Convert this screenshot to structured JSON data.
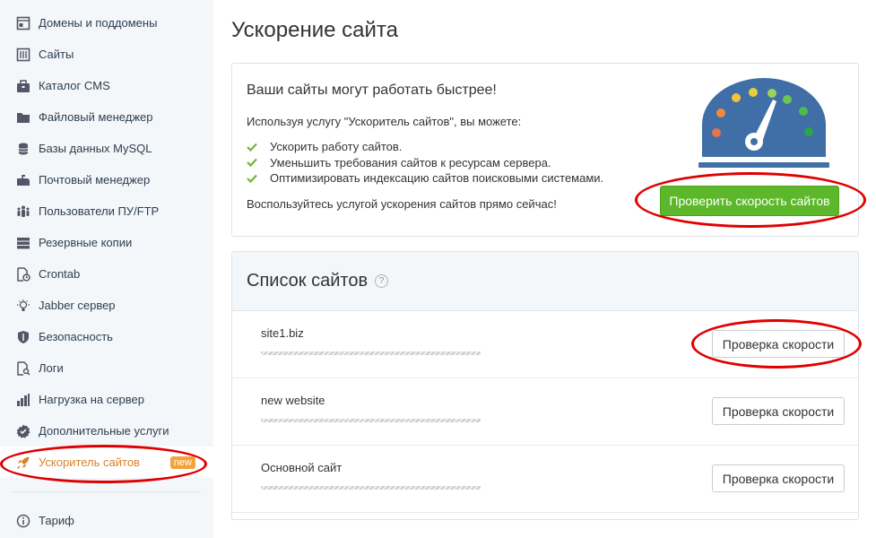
{
  "sidebar": {
    "items": [
      {
        "label": "Домены и поддомены",
        "icon": "domains-icon"
      },
      {
        "label": "Сайты",
        "icon": "sites-icon"
      },
      {
        "label": "Каталог CMS",
        "icon": "cms-catalog-icon"
      },
      {
        "label": "Файловый менеджер",
        "icon": "folder-icon"
      },
      {
        "label": "Базы данных MySQL",
        "icon": "database-icon"
      },
      {
        "label": "Почтовый менеджер",
        "icon": "mailbox-icon"
      },
      {
        "label": "Пользователи ПУ/FTP",
        "icon": "users-icon"
      },
      {
        "label": "Резервные копии",
        "icon": "backup-icon"
      },
      {
        "label": "Crontab",
        "icon": "crontab-icon"
      },
      {
        "label": "Jabber сервер",
        "icon": "lightbulb-icon"
      },
      {
        "label": "Безопасность",
        "icon": "shield-icon"
      },
      {
        "label": "Логи",
        "icon": "logs-icon"
      },
      {
        "label": "Нагрузка на сервер",
        "icon": "server-load-icon"
      },
      {
        "label": "Дополнительные услуги",
        "icon": "gear-icon"
      },
      {
        "label": "Ускоритель сайтов",
        "icon": "rocket-icon",
        "badge": "new",
        "active": true
      }
    ],
    "tariff": {
      "label": "Тариф",
      "icon": "info-icon"
    }
  },
  "page": {
    "title": "Ускорение сайта"
  },
  "promo": {
    "heading": "Ваши сайты могут работать быстрее!",
    "intro": "Используя услугу \"Ускоритель сайтов\", вы можете:",
    "benefits": [
      "Ускорить работу сайтов.",
      "Уменьшить требования сайтов к ресурсам сервера.",
      "Оптимизировать индексацию сайтов поисковыми системами."
    ],
    "cta": "Воспользуйтесь услугой ускорения сайтов прямо сейчас!",
    "button": "Проверить скорость сайтов"
  },
  "sites": {
    "title": "Список сайтов",
    "help": "?",
    "button_label": "Проверка скорости",
    "rows": [
      {
        "name": "site1.biz"
      },
      {
        "name": "new website"
      },
      {
        "name": "Основной сайт"
      }
    ]
  },
  "colors": {
    "accent": "#5cb82a",
    "active_nav": "#d9822b",
    "badge": "#f2a33a",
    "annotation": "#e00000",
    "gauge_body": "#3f6fa6"
  }
}
